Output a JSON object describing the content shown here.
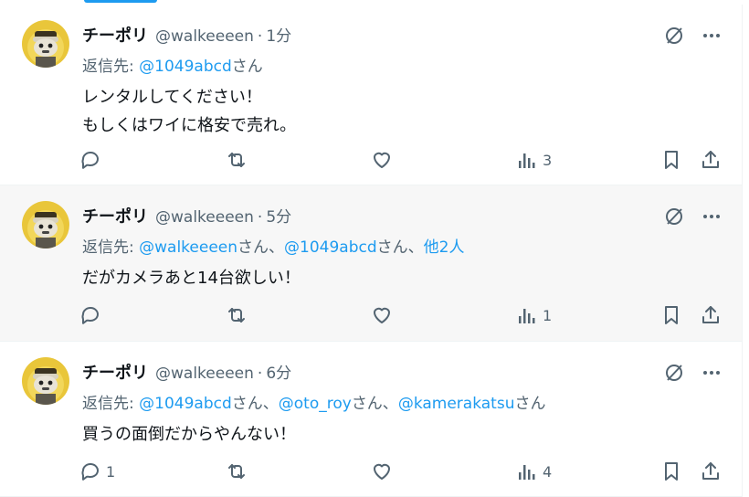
{
  "tweets": [
    {
      "name": "チーポリ",
      "handle": "@walkeeeen",
      "sep": "·",
      "time": "1分",
      "reply_label": "返信先:",
      "reply_to": [
        {
          "user": "@1049abcd",
          "suffix": "さん"
        }
      ],
      "text_lines": [
        "レンタルしてください！",
        "もしくはワイに格安で売れ。"
      ],
      "reply_count": "",
      "views_count": "3"
    },
    {
      "name": "チーポリ",
      "handle": "@walkeeeen",
      "sep": "·",
      "time": "5分",
      "reply_label": "返信先:",
      "reply_to": [
        {
          "user": "@walkeeeen",
          "suffix": "さん、"
        },
        {
          "user": "@1049abcd",
          "suffix": "さん、"
        }
      ],
      "reply_more": "他2人",
      "text_lines": [
        "だがカメラあと14台欲しい！"
      ],
      "reply_count": "",
      "views_count": "1"
    },
    {
      "name": "チーポリ",
      "handle": "@walkeeeen",
      "sep": "·",
      "time": "6分",
      "reply_label": "返信先:",
      "reply_to": [
        {
          "user": "@1049abcd",
          "suffix": "さん、"
        },
        {
          "user": "@oto_roy",
          "suffix": "さん、"
        },
        {
          "user": "@kamerakatsu",
          "suffix": "さん"
        }
      ],
      "text_lines": [
        "買うの面倒だからやんない！"
      ],
      "reply_count": "1",
      "views_count": "4"
    }
  ],
  "colors": {
    "link": "#1d9bf0",
    "muted": "#536471",
    "text": "#0f1419",
    "highlight_bg": "#f7f7f7"
  },
  "icons": [
    "reply-icon",
    "retweet-icon",
    "like-icon",
    "views-icon",
    "bookmark-icon",
    "share-icon",
    "grok-icon",
    "more-icon"
  ]
}
